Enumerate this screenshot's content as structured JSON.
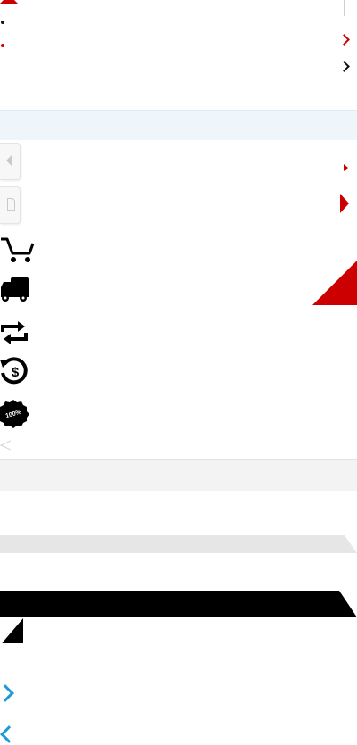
{
  "colors": {
    "accent_red": "#cc0000",
    "band_blue": "#eef6fb",
    "band_grey": "#f3f3f3",
    "nav_blue": "#1e9ad6",
    "black": "#000000"
  },
  "icons": [
    "shopping-cart-icon",
    "delivery-truck-icon",
    "exchange-arrows-icon",
    "money-back-icon",
    "guarantee-badge-icon"
  ],
  "badge": {
    "text": "100%"
  },
  "nav": {
    "next": "chevron-right-icon",
    "prev": "chevron-left-icon"
  }
}
